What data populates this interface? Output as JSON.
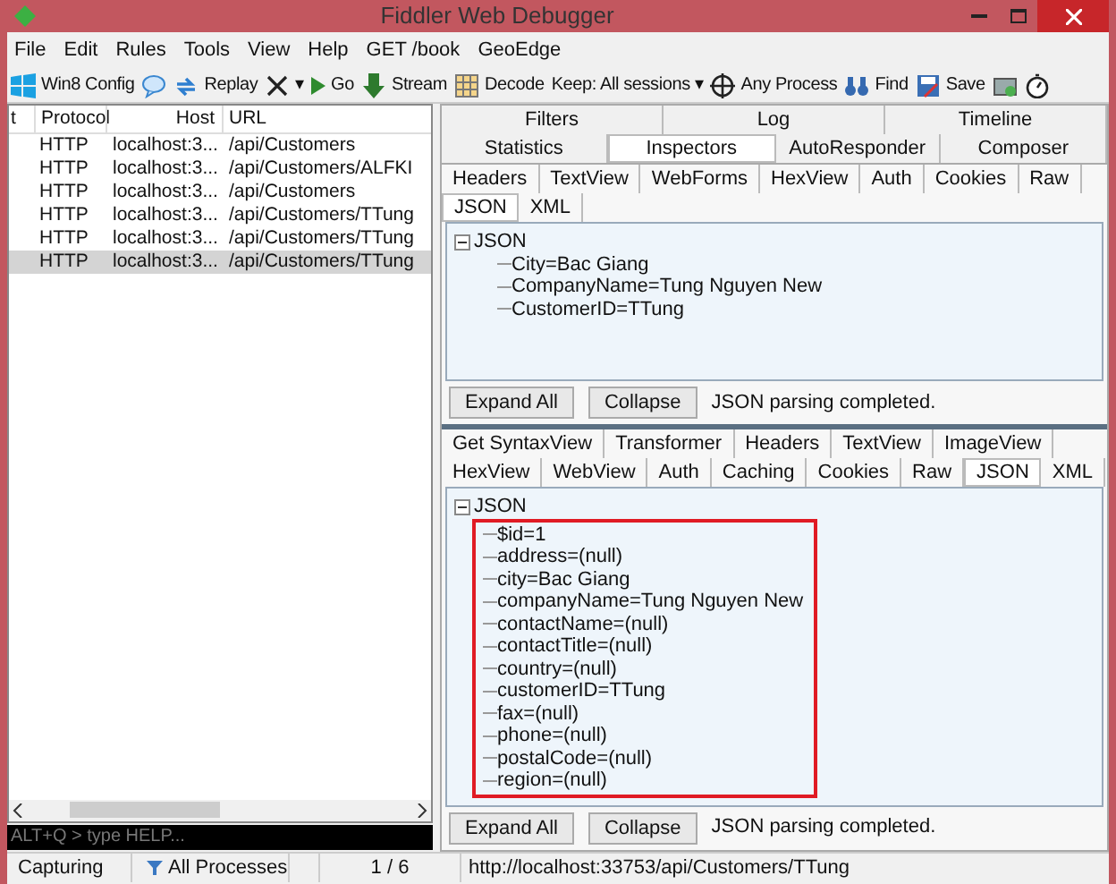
{
  "window": {
    "title": "Fiddler Web Debugger"
  },
  "menu": [
    "File",
    "Edit",
    "Rules",
    "Tools",
    "View",
    "Help",
    "GET /book",
    "GeoEdge"
  ],
  "toolbar": [
    {
      "kind": "win",
      "label": "Win8 Config"
    },
    {
      "kind": "comment"
    },
    {
      "kind": "replay",
      "label": "Replay"
    },
    {
      "kind": "remove",
      "label": "▾"
    },
    {
      "kind": "go",
      "label": "Go"
    },
    {
      "kind": "stream",
      "label": "Stream"
    },
    {
      "kind": "decode",
      "label": "Decode"
    },
    {
      "kind": "keep",
      "label": "Keep: All sessions ▾"
    },
    {
      "kind": "target",
      "label": "Any Process"
    },
    {
      "kind": "find",
      "label": "Find"
    },
    {
      "kind": "save",
      "label": "Save"
    },
    {
      "kind": "camera"
    },
    {
      "kind": "timer"
    }
  ],
  "sessions": {
    "columns": [
      "t",
      "Protocol",
      "Host",
      "URL"
    ],
    "rows": [
      {
        "protocol": "HTTP",
        "host": "localhost:3...",
        "url": "/api/Customers",
        "selected": false
      },
      {
        "protocol": "HTTP",
        "host": "localhost:3...",
        "url": "/api/Customers/ALFKI",
        "selected": false
      },
      {
        "protocol": "HTTP",
        "host": "localhost:3...",
        "url": "/api/Customers",
        "selected": false
      },
      {
        "protocol": "HTTP",
        "host": "localhost:3...",
        "url": "/api/Customers/TTung",
        "selected": false
      },
      {
        "protocol": "HTTP",
        "host": "localhost:3...",
        "url": "/api/Customers/TTung",
        "selected": false
      },
      {
        "protocol": "HTTP",
        "host": "localhost:3...",
        "url": "/api/Customers/TTung",
        "selected": true
      }
    ]
  },
  "quickexec": {
    "placeholder": "ALT+Q > type HELP..."
  },
  "top_tabs": [
    {
      "label": "Filters",
      "selected": false
    },
    {
      "label": "Log",
      "selected": false
    },
    {
      "label": "Timeline",
      "selected": false
    }
  ],
  "main_tabs": [
    {
      "label": "Statistics",
      "selected": false
    },
    {
      "label": "Inspectors",
      "selected": true
    },
    {
      "label": "AutoResponder",
      "selected": false
    },
    {
      "label": "Composer",
      "selected": false
    }
  ],
  "request": {
    "tabs": [
      {
        "label": "Headers",
        "selected": false
      },
      {
        "label": "TextView",
        "selected": false
      },
      {
        "label": "WebForms",
        "selected": false
      },
      {
        "label": "HexView",
        "selected": false
      },
      {
        "label": "Auth",
        "selected": false
      },
      {
        "label": "Cookies",
        "selected": false
      },
      {
        "label": "Raw",
        "selected": false
      },
      {
        "label": "JSON",
        "selected": true
      },
      {
        "label": "XML",
        "selected": false
      }
    ],
    "tree": {
      "label": "JSON",
      "expanded": true,
      "children": [
        {
          "label": "City=Bac Giang"
        },
        {
          "label": "CompanyName=Tung Nguyen New"
        },
        {
          "label": "CustomerID=TTung"
        }
      ]
    },
    "buttons": [
      "Expand All",
      "Collapse"
    ],
    "status": "JSON parsing completed."
  },
  "response": {
    "tabs": [
      {
        "label": "Get SyntaxView",
        "selected": false
      },
      {
        "label": "Transformer",
        "selected": false
      },
      {
        "label": "Headers",
        "selected": false
      },
      {
        "label": "TextView",
        "selected": false
      },
      {
        "label": "ImageView",
        "selected": false
      },
      {
        "label": "HexView",
        "selected": false
      },
      {
        "label": "WebView",
        "selected": false
      },
      {
        "label": "Auth",
        "selected": false
      },
      {
        "label": "Caching",
        "selected": false
      },
      {
        "label": "Cookies",
        "selected": false
      },
      {
        "label": "Raw",
        "selected": false
      },
      {
        "label": "JSON",
        "selected": true
      },
      {
        "label": "XML",
        "selected": false
      }
    ],
    "tree": {
      "label": "JSON",
      "expanded": true,
      "children": [
        {
          "label": "$id=1"
        },
        {
          "label": "address=(null)"
        },
        {
          "label": "city=Bac Giang"
        },
        {
          "label": "companyName=Tung Nguyen New"
        },
        {
          "label": "contactName=(null)"
        },
        {
          "label": "contactTitle=(null)"
        },
        {
          "label": "country=(null)"
        },
        {
          "label": "customerID=TTung"
        },
        {
          "label": "fax=(null)"
        },
        {
          "label": "phone=(null)"
        },
        {
          "label": "postalCode=(null)"
        },
        {
          "label": "region=(null)"
        }
      ]
    },
    "buttons": [
      "Expand All",
      "Collapse"
    ],
    "status": "JSON parsing completed."
  },
  "status_bar": {
    "capture": "Capturing",
    "processes": "All Processes",
    "count": "1 / 6",
    "url": "http://localhost:33753/api/Customers/TTung"
  }
}
